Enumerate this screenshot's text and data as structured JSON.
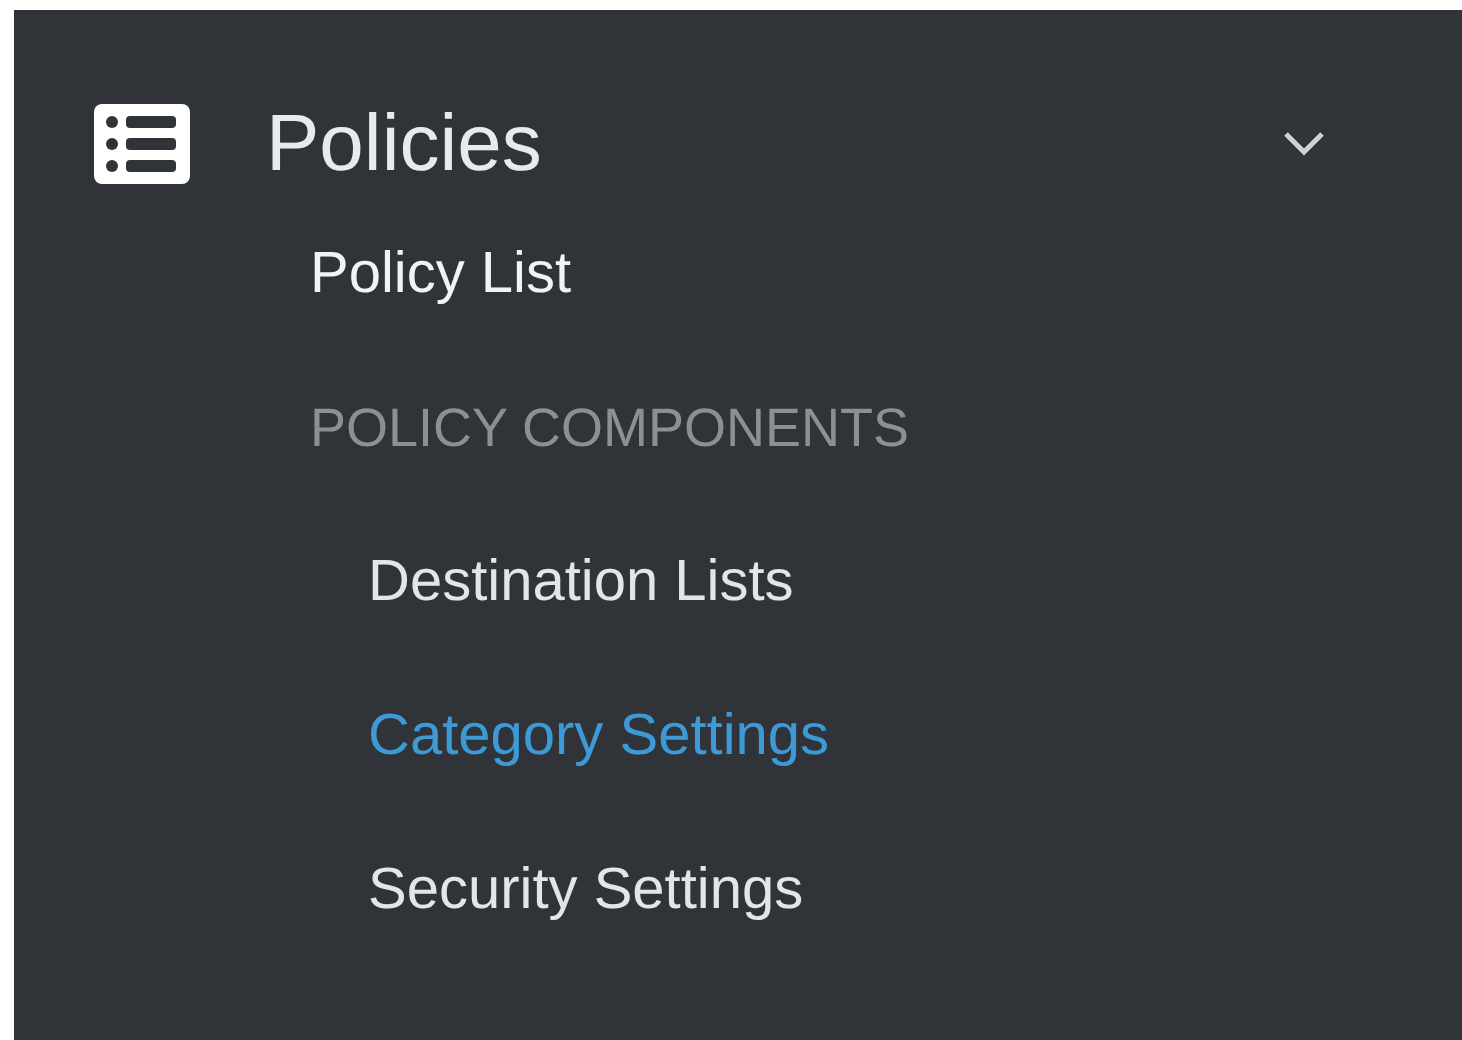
{
  "section": {
    "title": "Policies",
    "expanded": true
  },
  "items": [
    {
      "kind": "link",
      "label": "Policy List"
    },
    {
      "kind": "header",
      "label": "POLICY COMPONENTS",
      "children": [
        {
          "label": "Destination Lists",
          "selected": false
        },
        {
          "label": "Category Settings",
          "selected": true
        },
        {
          "label": "Security Settings",
          "selected": false
        }
      ]
    }
  ]
}
